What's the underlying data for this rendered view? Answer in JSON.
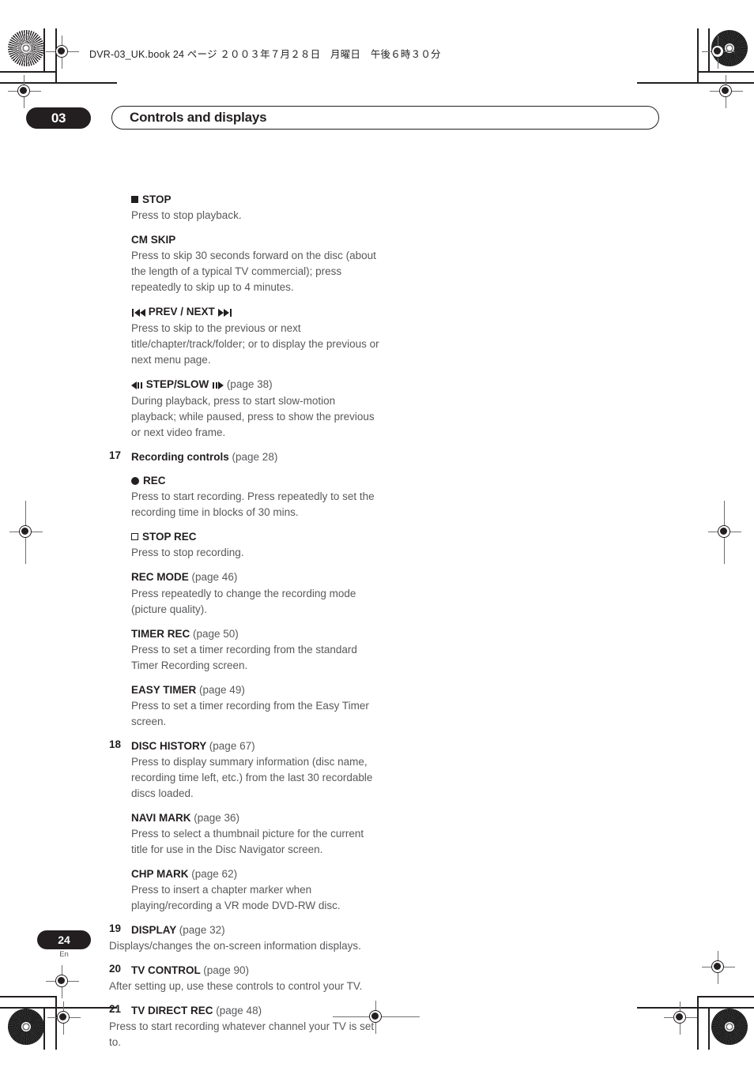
{
  "print_marks": {
    "book_header": "DVR-03_UK.book  24 ページ  ２００３年７月２８日　月曜日　午後６時３０分"
  },
  "chapter": {
    "number": "03",
    "title": "Controls and displays"
  },
  "content": [
    {
      "id": "stop",
      "indent": true,
      "icon": "square-filled-icon",
      "head": "STOP",
      "ref": "",
      "body": "Press to stop playback."
    },
    {
      "id": "cm-skip",
      "indent": true,
      "icon": "",
      "head": "CM SKIP",
      "ref": "",
      "body": "Press to skip 30 seconds forward on the disc (about the length of a typical TV commercial); press repeatedly to skip up to 4 minutes."
    },
    {
      "id": "prev-next",
      "indent": true,
      "icon": "prev-next-icon",
      "head": "PREV / NEXT",
      "ref": "",
      "body": "Press to skip to the previous or next title/chapter/track/folder; or to display the previous or next menu page."
    },
    {
      "id": "step-slow",
      "indent": true,
      "icon": "step-slow-icon",
      "head": "STEP/SLOW",
      "ref": "(page 38)",
      "body": "During playback, press to start slow-motion playback; while paused, press to show the previous or next video frame."
    },
    {
      "id": "recording-controls",
      "number": "17",
      "icon": "",
      "head": "Recording controls",
      "ref": "(page 28)",
      "body": ""
    },
    {
      "id": "rec",
      "indent": true,
      "icon": "circle-filled-icon",
      "head": "REC",
      "ref": "",
      "body": "Press to start recording. Press repeatedly to set the recording time in blocks of 30 mins."
    },
    {
      "id": "stop-rec",
      "indent": true,
      "icon": "square-open-icon",
      "head": "STOP REC",
      "ref": "",
      "body": "Press to stop recording."
    },
    {
      "id": "rec-mode",
      "indent": true,
      "icon": "",
      "head": "REC MODE",
      "ref": "(page 46)",
      "body": "Press repeatedly to change the recording mode (picture quality)."
    },
    {
      "id": "timer-rec",
      "indent": true,
      "icon": "",
      "head": "TIMER REC",
      "ref": "(page 50)",
      "body": "Press to set a timer recording from the standard Timer Recording screen."
    },
    {
      "id": "easy-timer",
      "indent": true,
      "icon": "",
      "head": "EASY TIMER",
      "ref": "(page 49)",
      "body": "Press to set a timer recording from the Easy Timer screen."
    },
    {
      "id": "disc-history",
      "number": "18",
      "icon": "",
      "head": "DISC HISTORY",
      "ref": "(page 67)",
      "body": "Press to display summary information (disc name, recording time left, etc.) from the last 30 recordable discs loaded."
    },
    {
      "id": "navi-mark",
      "indent": true,
      "icon": "",
      "head": "NAVI MARK",
      "ref": "(page 36)",
      "body": "Press to select a thumbnail picture for the current title for use in the Disc Navigator screen."
    },
    {
      "id": "chp-mark",
      "indent": true,
      "icon": "",
      "head": "CHP MARK",
      "ref": "(page 62)",
      "body": "Press to insert a chapter marker when playing/recording a VR mode DVD-RW disc."
    },
    {
      "id": "display",
      "number": "19",
      "flush": true,
      "icon": "",
      "head": "DISPLAY",
      "ref": "(page 32)",
      "body": "Displays/changes the on-screen information displays."
    },
    {
      "id": "tv-control",
      "number": "20",
      "flush": true,
      "icon": "",
      "head": "TV CONTROL",
      "ref": "(page 90)",
      "body": "After setting up, use these controls to control your TV."
    },
    {
      "id": "tv-direct-rec",
      "number": "21",
      "flush": true,
      "icon": "",
      "head": "TV DIRECT REC",
      "ref": "(page 48)",
      "body": "Press to start recording whatever channel your TV is set to."
    }
  ],
  "footer": {
    "page_number": "24",
    "language": "En"
  },
  "colors": {
    "ink": "#231f20",
    "body_text": "#58595b",
    "registration": "#6f6f6f"
  }
}
